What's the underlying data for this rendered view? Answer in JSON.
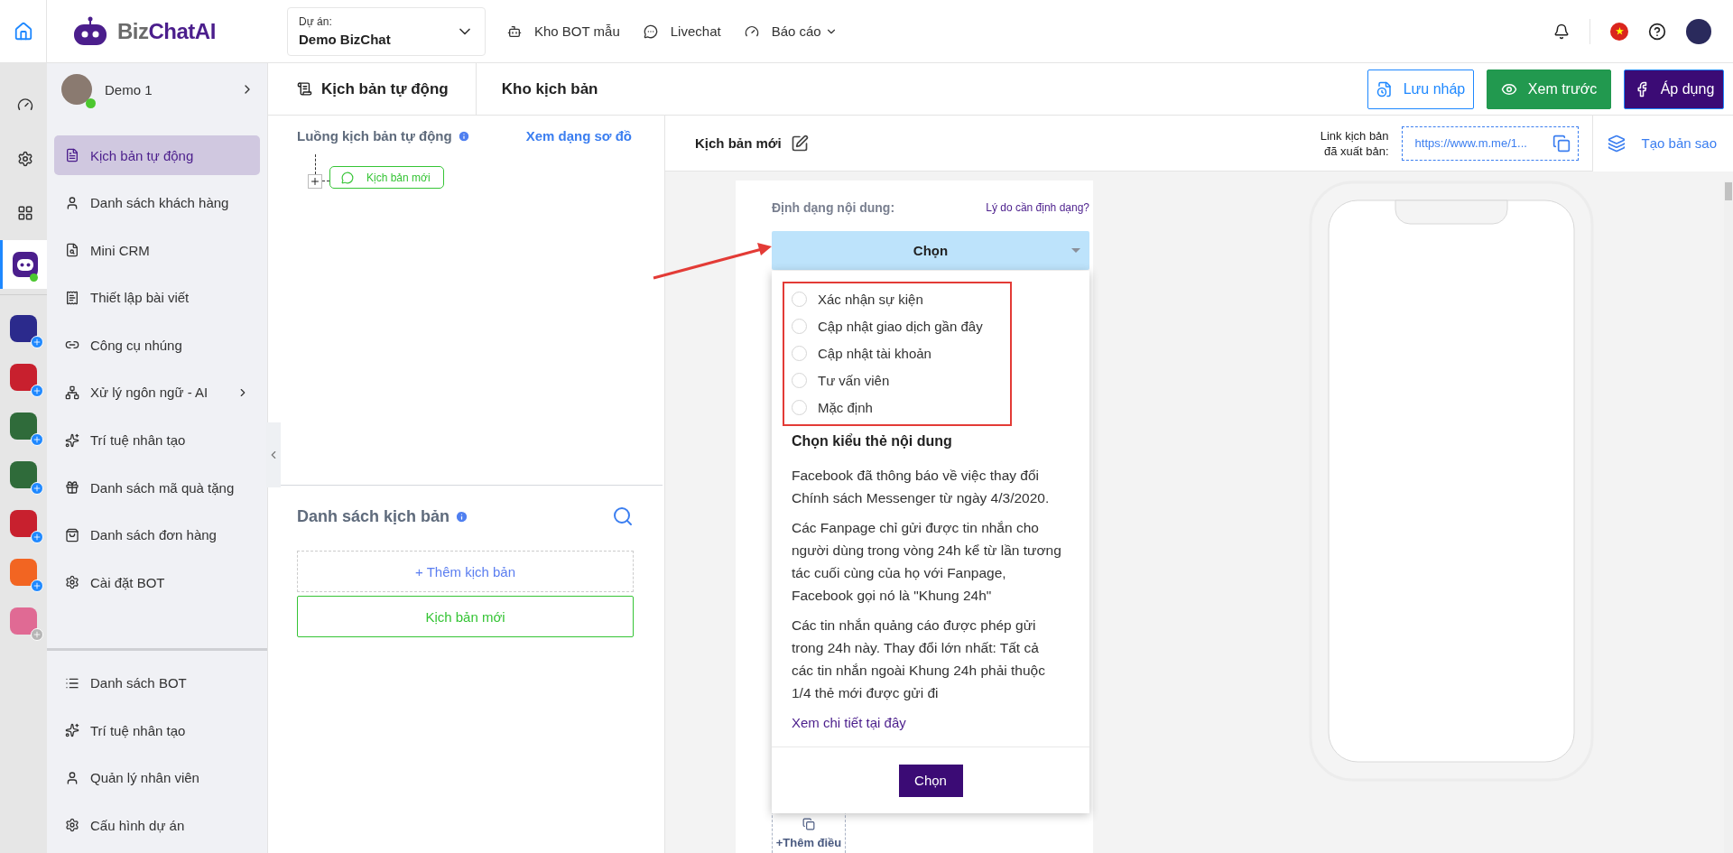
{
  "topbar": {
    "logo": {
      "prefix": "Biz",
      "suffix": "ChatAI"
    },
    "project": {
      "label": "Dự án:",
      "value": "Demo BizChat"
    },
    "nav": [
      {
        "label": "Kho BOT mẫu",
        "has_caret": false
      },
      {
        "label": "Livechat",
        "has_caret": false
      },
      {
        "label": "Báo cáo",
        "has_caret": true
      }
    ]
  },
  "rail": {
    "items": [
      {
        "selected": false
      },
      {
        "selected": false
      },
      {
        "selected": false
      },
      {
        "selected": true
      }
    ],
    "apps": [
      {
        "color": "#2b2a8c",
        "enabled": true
      },
      {
        "color": "#c8202e",
        "enabled": true
      },
      {
        "color": "#2f6b3a",
        "enabled": true
      },
      {
        "color": "#2f6b3a",
        "enabled": true
      },
      {
        "color": "#c8202e",
        "enabled": true
      },
      {
        "color": "#f26522",
        "enabled": true
      },
      {
        "color": "#e06a94",
        "enabled": false
      }
    ]
  },
  "sidebar": {
    "user": {
      "name": "Demo 1",
      "online": true
    },
    "items": [
      {
        "label": "Kịch bản tự động",
        "selected": true,
        "has_submenu": false
      },
      {
        "label": "Danh sách khách hàng",
        "selected": false,
        "has_submenu": false
      },
      {
        "label": "Mini CRM",
        "selected": false,
        "has_submenu": false
      },
      {
        "label": "Thiết lập bài viết",
        "selected": false,
        "has_submenu": false
      },
      {
        "label": "Công cụ nhúng",
        "selected": false,
        "has_submenu": false
      },
      {
        "label": "Xử lý ngôn ngữ - AI",
        "selected": false,
        "has_submenu": true
      },
      {
        "label": "Trí tuệ nhân tạo",
        "selected": false,
        "has_submenu": false
      },
      {
        "label": "Danh sách mã quà tặng",
        "selected": false,
        "has_submenu": false
      },
      {
        "label": "Danh sách đơn hàng",
        "selected": false,
        "has_submenu": false
      },
      {
        "label": "Cài đặt BOT",
        "selected": false,
        "has_submenu": false
      }
    ],
    "bottom_items": [
      {
        "label": "Danh sách BOT",
        "selected": false
      },
      {
        "label": "Trí tuệ nhân tạo",
        "selected": false
      },
      {
        "label": "Quản lý nhân viên",
        "selected": false
      },
      {
        "label": "Cấu hình dự án",
        "selected": false
      }
    ]
  },
  "breadcrumb": [
    {
      "label": "Kịch bản tự động"
    },
    {
      "label": "Kho kịch bản"
    }
  ],
  "actions": [
    {
      "label": "Lưu nháp",
      "kind": "outline"
    },
    {
      "label": "Xem trước",
      "kind": "success"
    },
    {
      "label": "Áp dụng",
      "kind": "primary"
    }
  ],
  "flow": {
    "title": "Luồng kịch bản tự động",
    "link": "Xem dạng sơ đồ",
    "nodes": [
      {
        "label": "Kịch bản mới"
      }
    ]
  },
  "scripts": {
    "title": "Danh sách kịch bản",
    "add_label": "+ Thêm kịch bản",
    "items": [
      {
        "label": "Kịch bản mới",
        "selected": true
      }
    ]
  },
  "editor": {
    "title": "Kịch bản mới",
    "link_label": "Link kịch bản đã xuất bản:",
    "link_value": "https://www.m.me/1...",
    "copy_label": "Tạo bản sao"
  },
  "card": {
    "format_label": "Định dạng nội dung:",
    "reason_link": "Lý do cần định dạng?",
    "select_value": "Chọn",
    "options": [
      {
        "label": "Xác nhận sự kiện",
        "selected": false
      },
      {
        "label": "Cập nhật giao dịch gần đây",
        "selected": false
      },
      {
        "label": "Cập nhật tài khoản",
        "selected": false
      },
      {
        "label": "Tư vấn viên",
        "selected": false
      },
      {
        "label": "Mặc định",
        "selected": false
      }
    ],
    "info_title": "Chọn kiểu thẻ nội dung",
    "paragraphs": [
      "Facebook đã thông báo về việc thay đổi Chính sách Messenger từ ngày 4/3/2020.",
      "Các Fanpage chỉ gửi được tin nhắn cho người dùng trong vòng 24h kể từ lần tương tác cuối cùng của họ với Fanpage, Facebook gọi nó là \"Khung 24h\"",
      "Các tin nhắn quảng cáo được phép gửi trong 24h này. Thay đổi lớn nhất: Tất cả các tin nhắn ngoài Khung 24h phải thuộc 1/4 thẻ mới được gửi đi"
    ],
    "detail_link": "Xem chi tiết tại đây",
    "confirm": "Chọn",
    "add_condition": "+Thêm điều"
  }
}
